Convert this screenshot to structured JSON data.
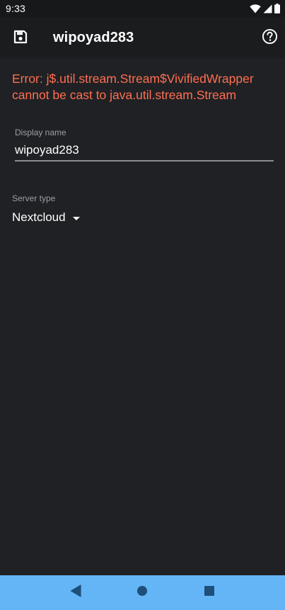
{
  "status_bar": {
    "time": "9:33"
  },
  "app_bar": {
    "title": "wipoyad283"
  },
  "error": {
    "message": "Error: j$.util.stream.Stream$VivifiedWrapper cannot be cast to java.util.stream.Stream"
  },
  "form": {
    "display_name_label": "Display name",
    "display_name_value": "wipoyad283",
    "server_type_label": "Server type",
    "server_type_value": "Nextcloud"
  },
  "colors": {
    "background": "#202124",
    "app_bar": "#1b1c1e",
    "error": "#ff6f52",
    "nav_bar": "#64b5f6"
  }
}
